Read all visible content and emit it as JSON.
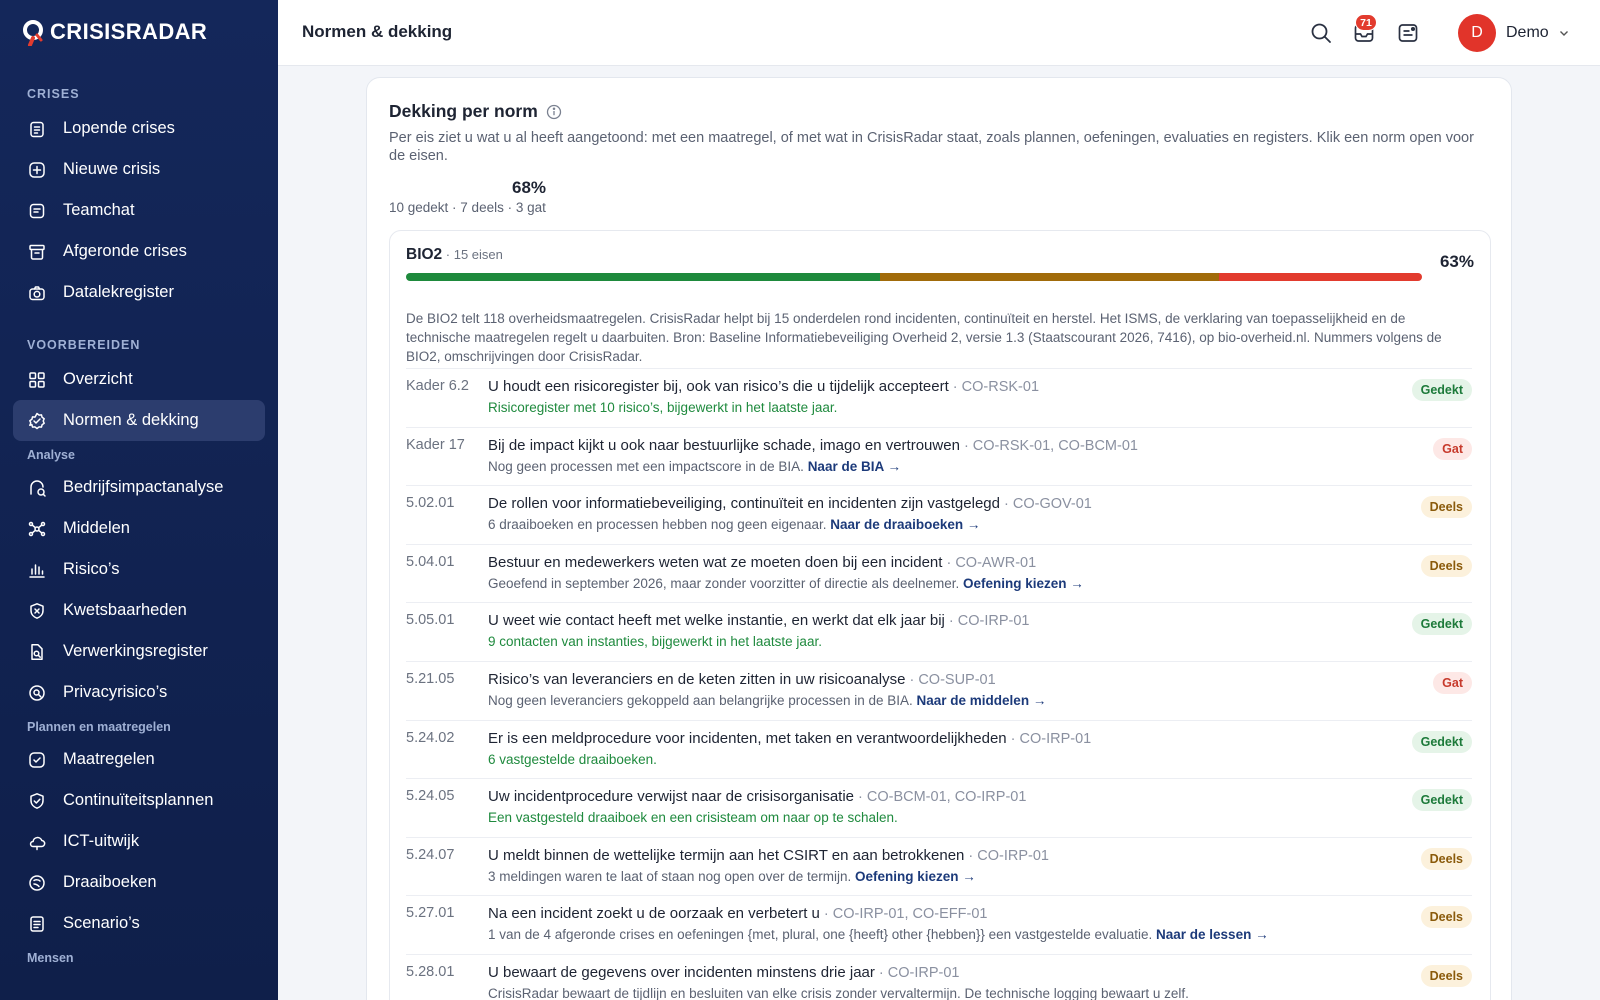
{
  "brand": {
    "name": "CRISISRADAR"
  },
  "sidebar": {
    "sections": [
      {
        "heading": "CRISES",
        "style": "section",
        "items": [
          {
            "label": "Lopende crises",
            "icon": "clipboard-list-icon"
          },
          {
            "label": "Nieuwe crisis",
            "icon": "plus-square-icon"
          },
          {
            "label": "Teamchat",
            "icon": "chat-lines-icon"
          },
          {
            "label": "Afgeronde crises",
            "icon": "archive-icon"
          },
          {
            "label": "Datalekregister",
            "icon": "camera-icon"
          }
        ]
      },
      {
        "heading": "VOORBEREIDEN",
        "style": "section",
        "items": [
          {
            "label": "Overzicht",
            "icon": "grid-icon"
          },
          {
            "label": "Normen & dekking",
            "icon": "badge-check-icon",
            "active": true
          }
        ]
      },
      {
        "heading": "Analyse",
        "style": "sub",
        "items": [
          {
            "label": "Bedrijfsimpactanalyse",
            "icon": "impact-icon"
          },
          {
            "label": "Middelen",
            "icon": "network-icon"
          },
          {
            "label": "Risico’s",
            "icon": "bar-chart-icon"
          },
          {
            "label": "Kwetsbaarheden",
            "icon": "shield-x-icon"
          },
          {
            "label": "Verwerkingsregister",
            "icon": "doc-search-icon"
          },
          {
            "label": "Privacyrisico’s",
            "icon": "search-circle-icon"
          }
        ]
      },
      {
        "heading": "Plannen en maatregelen",
        "style": "sub",
        "items": [
          {
            "label": "Maatregelen",
            "icon": "check-square-icon"
          },
          {
            "label": "Continuïteitsplannen",
            "icon": "shield-check-icon"
          },
          {
            "label": "ICT-uitwijk",
            "icon": "cloud-icon"
          },
          {
            "label": "Draaiboeken",
            "icon": "book-icon"
          },
          {
            "label": "Scenario’s",
            "icon": "document-icon"
          }
        ]
      },
      {
        "heading": "Mensen",
        "style": "sub",
        "items": []
      }
    ]
  },
  "header": {
    "title": "Normen & dekking",
    "notification_count": "71",
    "user_initial": "D",
    "user_name": "Demo"
  },
  "coverage": {
    "title": "Dekking per norm",
    "description": "Per eis ziet u wat u al heeft aangetoond: met een maatregel, of met wat in CrisisRadar staat, zoals plannen, oefeningen, evaluaties en registers. Klik een norm open voor de eisen.",
    "total_percent": "68%",
    "summary": "10 gedekt · 7 deels · 3 gat",
    "norm": {
      "name": "BIO2",
      "count": " · 15 eisen",
      "percent": "63%",
      "bar": {
        "covered": 46.7,
        "partial": 33.3,
        "gap": 20.0,
        "colors": {
          "covered": "#1e8a3c",
          "partial": "#a16b0a",
          "gap": "#e23b2e"
        }
      },
      "description": "De BIO2 telt 118 overheidsmaatregelen. CrisisRadar helpt bij 15 onderdelen rond incidenten, continuïteit en herstel. Het ISMS, de verklaring van toepasselijkheid en de technische maatregelen regelt u daarbuiten. Bron: Baseline Informatiebeveiliging Overheid 2, versie 1.3 (Staatscourant 2026, 7416), op bio-overheid.nl. Nummers volgens de BIO2, omschrijvingen door CrisisRadar.",
      "requirements": [
        {
          "code": "Kader 6.2",
          "title": "U houdt een risicoregister bij, ook van risico’s die u tijdelijk accepteert",
          "ref": " · CO-RSK-01",
          "note": "Risicoregister met 10 risico’s, bijgewerkt in het laatste jaar.",
          "link": "",
          "status": "Gedekt",
          "kind": "gedekt"
        },
        {
          "code": "Kader 17",
          "title": "Bij de impact kijkt u ook naar bestuurlijke schade, imago en vertrouwen",
          "ref": " · CO-RSK-01, CO-BCM-01",
          "note": "Nog geen processen met een impactscore in de BIA. ",
          "link": "Naar de BIA →",
          "status": "Gat",
          "kind": "gat"
        },
        {
          "code": "5.02.01",
          "title": "De rollen voor informatiebeveiliging, continuïteit en incidenten zijn vastgelegd",
          "ref": " · CO-GOV-01",
          "note": "6 draaiboeken en processen hebben nog geen eigenaar. ",
          "link": "Naar de draaiboeken →",
          "status": "Deels",
          "kind": "deels"
        },
        {
          "code": "5.04.01",
          "title": "Bestuur en medewerkers weten wat ze moeten doen bij een incident",
          "ref": " · CO-AWR-01",
          "note": "Geoefend in september 2026, maar zonder voorzitter of directie als deelnemer. ",
          "link": "Oefening kiezen →",
          "status": "Deels",
          "kind": "deels"
        },
        {
          "code": "5.05.01",
          "title": "U weet wie contact heeft met welke instantie, en werkt dat elk jaar bij",
          "ref": " · CO-IRP-01",
          "note": "9 contacten van instanties, bijgewerkt in het laatste jaar.",
          "link": "",
          "status": "Gedekt",
          "kind": "gedekt"
        },
        {
          "code": "5.21.05",
          "title": "Risico’s van leveranciers en de keten zitten in uw risicoanalyse",
          "ref": " · CO-SUP-01",
          "note": "Nog geen leveranciers gekoppeld aan belangrijke processen in de BIA. ",
          "link": "Naar de middelen →",
          "status": "Gat",
          "kind": "gat"
        },
        {
          "code": "5.24.02",
          "title": "Er is een meldprocedure voor incidenten, met taken en verantwoordelijkheden",
          "ref": " · CO-IRP-01",
          "note": "6 vastgestelde draaiboeken.",
          "link": "",
          "status": "Gedekt",
          "kind": "gedekt"
        },
        {
          "code": "5.24.05",
          "title": "Uw incidentprocedure verwijst naar de crisisorganisatie",
          "ref": " · CO-BCM-01, CO-IRP-01",
          "note": "Een vastgesteld draaiboek en een crisisteam om naar op te schalen.",
          "link": "",
          "status": "Gedekt",
          "kind": "gedekt"
        },
        {
          "code": "5.24.07",
          "title": "U meldt binnen de wettelijke termijn aan het CSIRT en aan betrokkenen",
          "ref": " · CO-IRP-01",
          "note": "3 meldingen waren te laat of staan nog open over de termijn. ",
          "link": "Oefening kiezen →",
          "status": "Deels",
          "kind": "deels"
        },
        {
          "code": "5.27.01",
          "title": "Na een incident zoekt u de oorzaak en verbetert u",
          "ref": " · CO-IRP-01, CO-EFF-01",
          "note": "1 van de 4 afgeronde crises en oefeningen {met, plural, one {heeft} other {hebben}} een vastgestelde evaluatie. ",
          "link": "Naar de lessen →",
          "status": "Deels",
          "kind": "deels"
        },
        {
          "code": "5.28.01",
          "title": "U bewaart de gegevens over incidenten minstens drie jaar",
          "ref": " · CO-IRP-01",
          "note": "CrisisRadar bewaart de tijdlijn en besluiten van elke crisis zonder vervaltermijn. De technische logging bewaart u zelf.",
          "link": "",
          "status": "Deels",
          "kind": "deels"
        }
      ]
    }
  }
}
